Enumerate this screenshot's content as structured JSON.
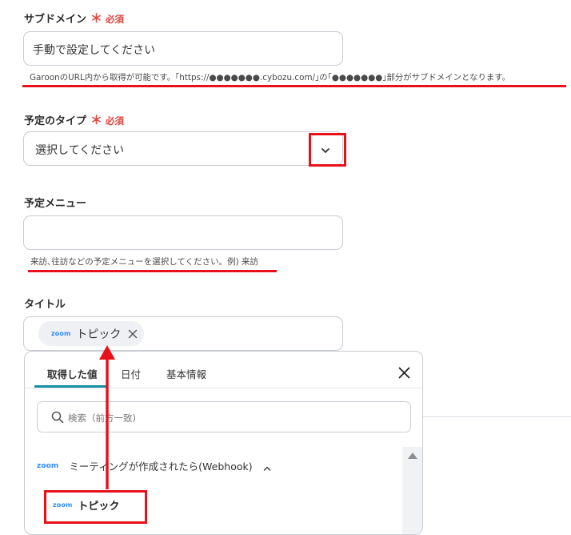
{
  "subdomain": {
    "label": "サブドメイン",
    "required_mark": "＊",
    "required_text": "必須",
    "value": "手動で設定してください",
    "help": "GaroonのURL内から取得が可能です。｢https://●●●●●●●.cybozu.com/｣の｢●●●●●●●｣部分がサブドメインとなります。"
  },
  "schedule_type": {
    "label": "予定のタイプ",
    "required_mark": "＊",
    "required_text": "必須",
    "value": "選択してください",
    "dropdown_icon": "chevron-down-icon"
  },
  "schedule_menu": {
    "label": "予定メニュー",
    "value": "",
    "help": "来訪､往訪などの予定メニューを選択してください。例) 来訪"
  },
  "title_field": {
    "label": "タイトル",
    "chip": {
      "brand": "zoom",
      "label": "トピック",
      "remove_icon": "close-icon"
    }
  },
  "picker": {
    "tabs": [
      {
        "label": "取得した値",
        "active": true
      },
      {
        "label": "日付",
        "active": false
      },
      {
        "label": "基本情報",
        "active": false
      }
    ],
    "close_icon": "close-icon",
    "search_placeholder": "検索（前方一致)",
    "group": {
      "brand": "zoom",
      "label": "ミーティングが作成されたら(Webhook)",
      "icon": "chevron-up-icon"
    },
    "items": [
      {
        "brand": "zoom",
        "label": "トピック"
      }
    ]
  },
  "colors": {
    "accent_red": "#e8101a",
    "required": "#e0463f",
    "zoom_blue": "#2D8CFF",
    "tab_active": "#1a8fa0"
  }
}
